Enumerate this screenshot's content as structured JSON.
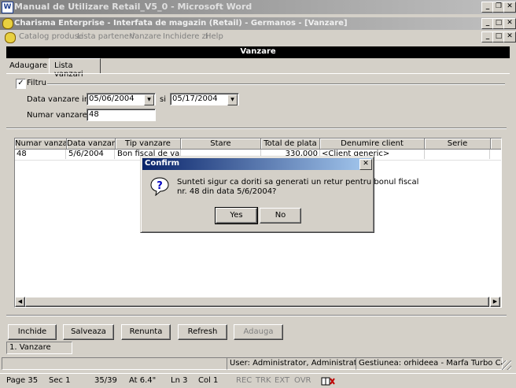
{
  "word": {
    "title": "Manual de Utilizare Retail_V5_0 - Microsoft Word",
    "status": {
      "page": "Page 35",
      "sec": "Sec 1",
      "pages": "35/39",
      "at": "At 6.4\"",
      "ln": "Ln 3",
      "col": "Col 1",
      "rec": "REC",
      "trk": "TRK",
      "ext": "EXT",
      "ovr": "OVR"
    }
  },
  "app": {
    "title": "Charisma Enterprise - Interfata de magazin (Retail) - Germanos - [Vanzare]",
    "menu": [
      "Catalog produse",
      "Lista parteneri",
      "Vanzare",
      "Inchidere zi",
      "Help"
    ],
    "form_title": "Vanzare"
  },
  "tabs": [
    {
      "label": "Adaugare"
    },
    {
      "label": "Lista vanzari"
    }
  ],
  "filter": {
    "label": "Filtru",
    "checked": true,
    "date_label": "Data vanzare intre",
    "date_from": "05/06/2004",
    "and_label": "si",
    "date_to": "05/17/2004",
    "number_label": "Numar vanzare",
    "number_value": "48"
  },
  "grid": {
    "columns": [
      "Numar vanzare",
      "Data vanzarii",
      "Tip vanzare",
      "Stare",
      "Total de plata",
      "Denumire client",
      "Serie"
    ],
    "rows": [
      [
        "48",
        "5/6/2004",
        "Bon fiscal de vanzare",
        "",
        "330,000",
        "<Client generic>",
        ""
      ]
    ]
  },
  "buttons": {
    "inchide": "Inchide",
    "salveaza": "Salveaza",
    "renunta": "Renunta",
    "refresh": "Refresh",
    "adauga": "Adauga"
  },
  "window_list_item": "1. Vanzare",
  "statusbar": {
    "user": "User: Administrator, Administrator",
    "gestiune": "Gestiunea: orhideea - Marfa Turbo Carre"
  },
  "dialog": {
    "title": "Confirm",
    "message_line1": "Sunteti sigur ca doriti sa generati un retur pentru bonul fiscal",
    "message_line2": "nr. 48 din data 5/6/2004?",
    "yes": "Yes",
    "no": "No"
  }
}
